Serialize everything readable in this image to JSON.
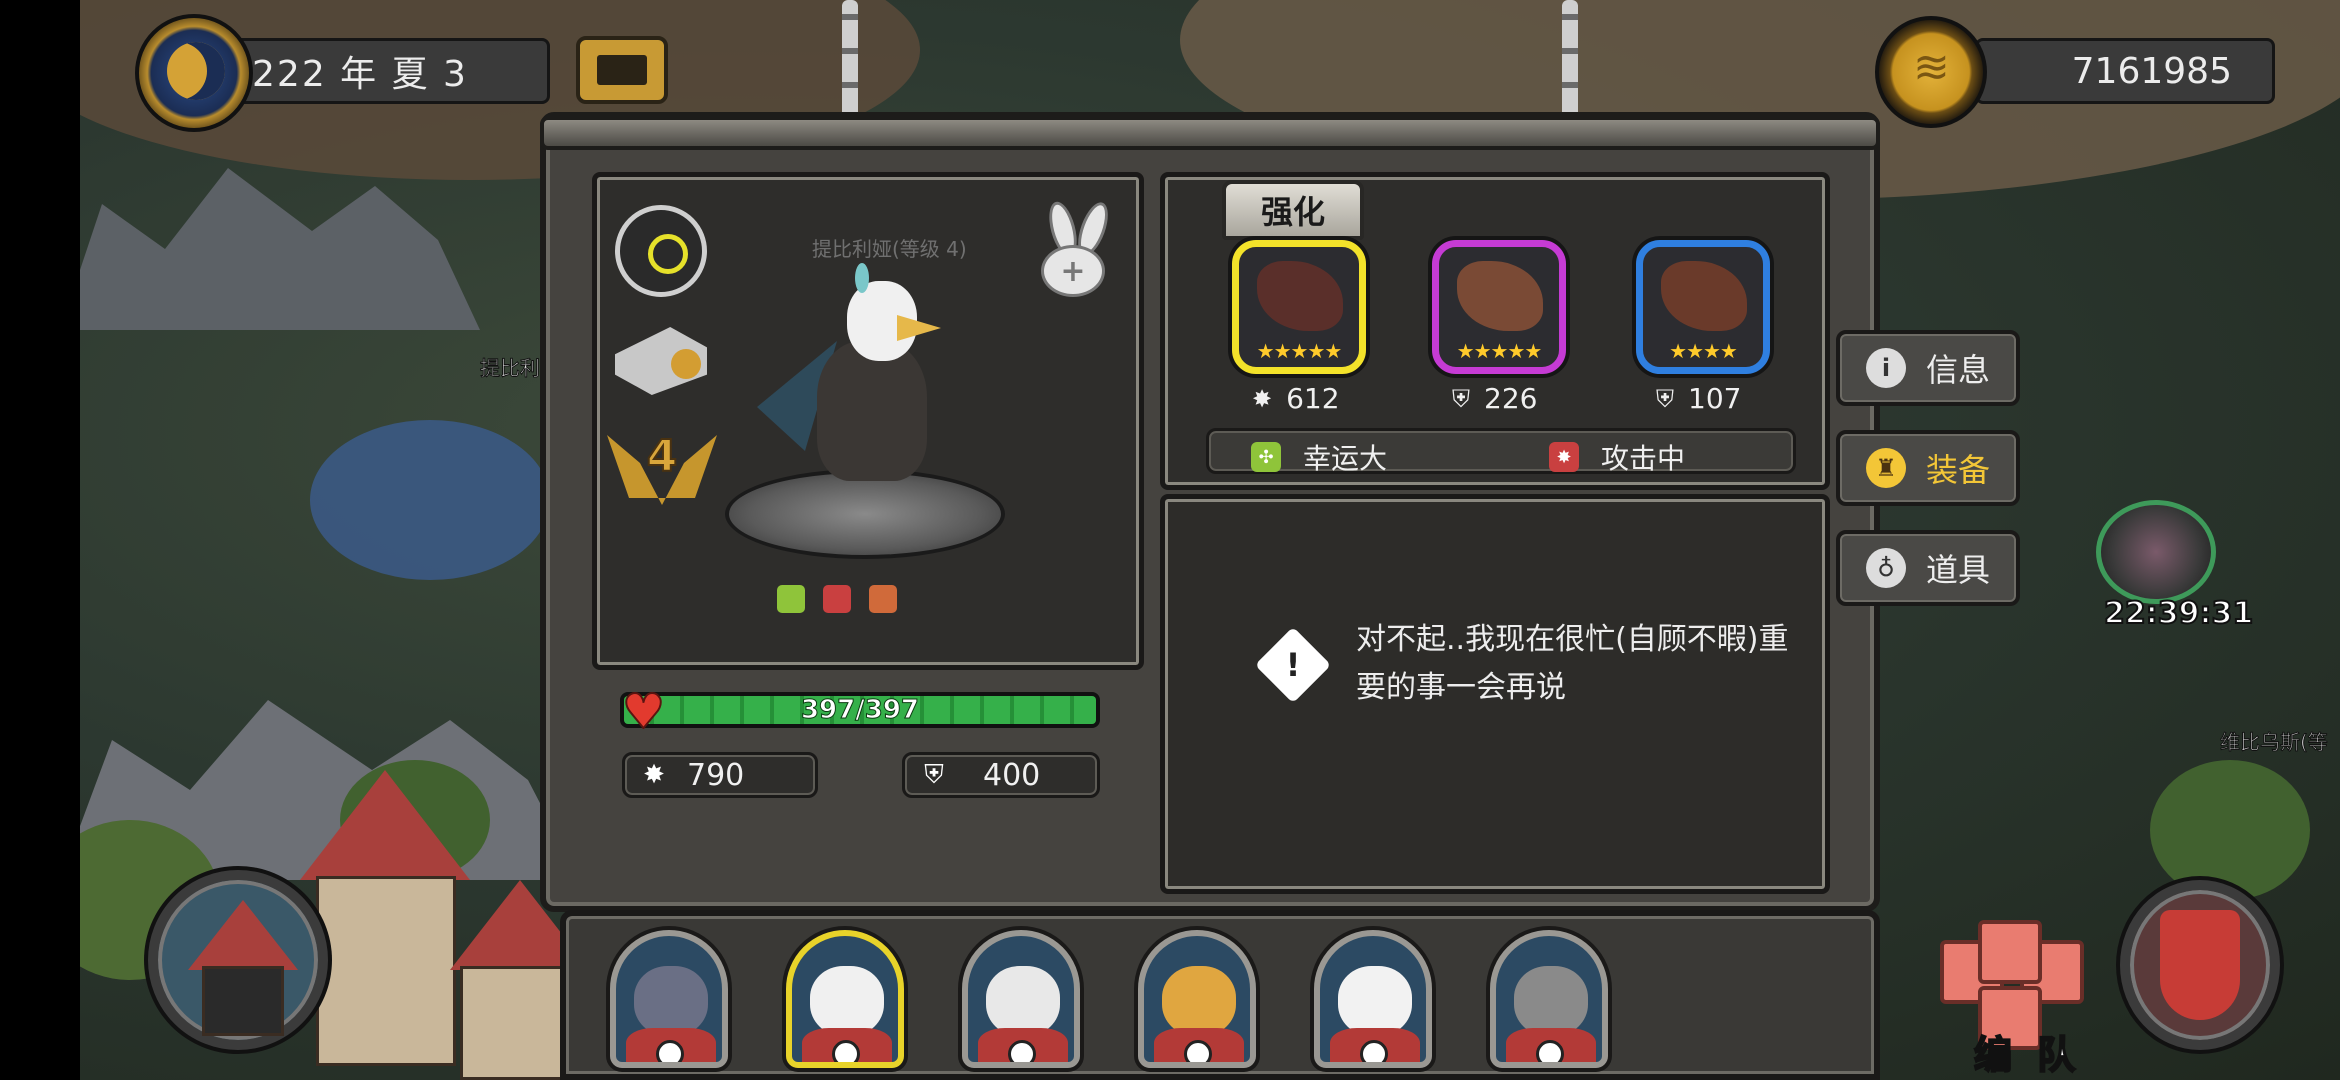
{
  "top_bar": {
    "date": "222 年 夏 3",
    "gold": "7161985"
  },
  "hero": {
    "name_faint": "提比利娅(等级 4)",
    "level": "4",
    "hp_text": "397/397",
    "hp_fraction": 1.0,
    "attack": "790",
    "defense": "400"
  },
  "equipment": {
    "tab_label": "强化",
    "slots": [
      {
        "rarity_color": "#f3e22a",
        "stars": "★★★★★",
        "stat_icon": "attack-icon",
        "stat_value": "612"
      },
      {
        "rarity_color": "#c53bd4",
        "stars": "★★★★★",
        "stat_icon": "defense-icon",
        "stat_value": "226"
      },
      {
        "rarity_color": "#2f7fe0",
        "stars": "★★★★",
        "stat_icon": "defense-icon",
        "stat_value": "107"
      }
    ],
    "traits": [
      {
        "label": "幸运大",
        "icon": "luck-icon",
        "color": "#8fc43a"
      },
      {
        "label": "攻击中",
        "icon": "attack-trait-icon",
        "color": "#c94040"
      }
    ]
  },
  "dialog": {
    "text": "对不起..我现在很忙(自顾不暇)重要的事一会再说"
  },
  "side_tabs": [
    {
      "label": "信息",
      "icon": "info-icon"
    },
    {
      "label": "装备",
      "icon": "helmet-icon",
      "active": true
    },
    {
      "label": "道具",
      "icon": "potion-icon"
    }
  ],
  "map": {
    "label_left": "提比利娅(等",
    "label_right": "维比乌斯(等"
  },
  "timer": "22:39:31",
  "team_button": "编 队",
  "roster": [
    {
      "name": "boar-hero",
      "face_color": "#6a6f85",
      "selected": false
    },
    {
      "name": "eagle-hero",
      "face_color": "#f0f0f0",
      "selected": true
    },
    {
      "name": "polar-bear-hero",
      "face_color": "#e8e8e8",
      "selected": false
    },
    {
      "name": "leopard-hero",
      "face_color": "#e0a640",
      "selected": false
    },
    {
      "name": "sheep-hero",
      "face_color": "#f2f2f2",
      "selected": false
    },
    {
      "name": "elephant-hero",
      "face_color": "#8a8a8a",
      "selected": false
    }
  ]
}
